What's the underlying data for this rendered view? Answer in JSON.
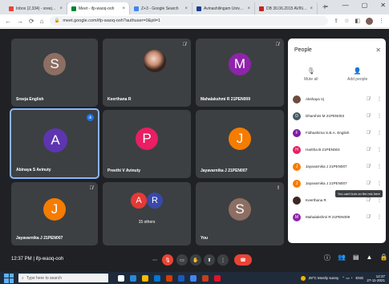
{
  "browser": {
    "tabs": [
      {
        "label": "Inbox (2,334) - sreeja_eng@...",
        "color": "#ea4335",
        "active": false
      },
      {
        "label": "Meet - ifp-waoq-ooh",
        "color": "#00832d",
        "active": true
      },
      {
        "label": "Z+3 - Google Search",
        "color": "#4285f4",
        "active": false
      },
      {
        "label": "Avinashilingam University f...",
        "color": "#1a3d8f",
        "active": false
      },
      {
        "label": "DB 30.06.2015 AVINASHILI...",
        "color": "#c5221f",
        "active": false
      }
    ],
    "tab_close": "×",
    "new_tab": "+",
    "window_controls": [
      "⌄",
      "—",
      "▢",
      "✕"
    ],
    "url": "meet.google.com/ifp-waoq-ooh?authuser=0&pli=1"
  },
  "meeting": {
    "tiles": [
      {
        "name": "Sreeja English",
        "initial": "S",
        "color": "#8d6e63",
        "muted": false,
        "type": "avatar"
      },
      {
        "name": "Keerthana R",
        "initial": "",
        "color": "",
        "muted": true,
        "type": "photo"
      },
      {
        "name": "Mahalakshmi R 21PEN009",
        "initial": "M",
        "color": "#8e24aa",
        "muted": true,
        "type": "avatar"
      },
      {
        "name": "Abinaya S Avinuty",
        "initial": "A",
        "color": "#5e35b1",
        "muted": false,
        "type": "avatar",
        "speaking": true
      },
      {
        "name": "Preethi V Avinuty",
        "initial": "P",
        "color": "#e91e63",
        "muted": false,
        "type": "avatar"
      },
      {
        "name": "Jayavarnika J 21PEN007",
        "initial": "J",
        "color": "#f57c00",
        "muted": false,
        "type": "avatar"
      },
      {
        "name": "Jayavarnika J 21PEN007",
        "initial": "J",
        "color": "#f57c00",
        "muted": true,
        "type": "avatar"
      },
      {
        "name": "15 others",
        "initial": "",
        "color": "",
        "muted": false,
        "type": "group"
      },
      {
        "name": "You",
        "initial": "S",
        "color": "#8d6e63",
        "muted": false,
        "type": "avatar",
        "alert": true
      }
    ],
    "group_initials": [
      "A",
      "R"
    ],
    "group_colors": [
      "#e53935",
      "#3949ab"
    ],
    "meeting_time": "12:37 PM",
    "meeting_code": "ifp-waoq-ooh",
    "time_separator": "|"
  },
  "people_panel": {
    "title": "People",
    "mute_all": "Mute all",
    "add_people": "Add people",
    "participants": [
      {
        "name": "Akshaya Vj",
        "initial": "",
        "color": "#6d4c41"
      },
      {
        "name": "Dharshini M 21PEN003",
        "initial": "D",
        "color": "#455a64"
      },
      {
        "name": "Fidhashima S.B.A. English",
        "initial": "F",
        "color": "#7b1fa2"
      },
      {
        "name": "Haritha B 21PEN004",
        "initial": "H",
        "color": "#e91e63"
      },
      {
        "name": "Jayavarnika J 21PEN007",
        "initial": "J",
        "color": "#f57c00"
      },
      {
        "name": "Jayavarnika J 21PEN007",
        "initial": "J",
        "color": "#f57c00"
      },
      {
        "name": "Keerthana R",
        "initial": "",
        "color": "#3e2723"
      },
      {
        "name": "Mahalakshmi R 21PEN009",
        "initial": "M",
        "color": "#8e24aa"
      }
    ],
    "tooltip": "You can't turn on the mic here"
  },
  "taskbar": {
    "search_placeholder": "Type here to search",
    "weather": "29°C  Mostly sunny",
    "language": "ENG",
    "time": "12:37",
    "date": "27-11-2021"
  },
  "colors": {
    "meet_bg": "#202124",
    "tile_bg": "#3c4043",
    "red": "#ea4335"
  }
}
